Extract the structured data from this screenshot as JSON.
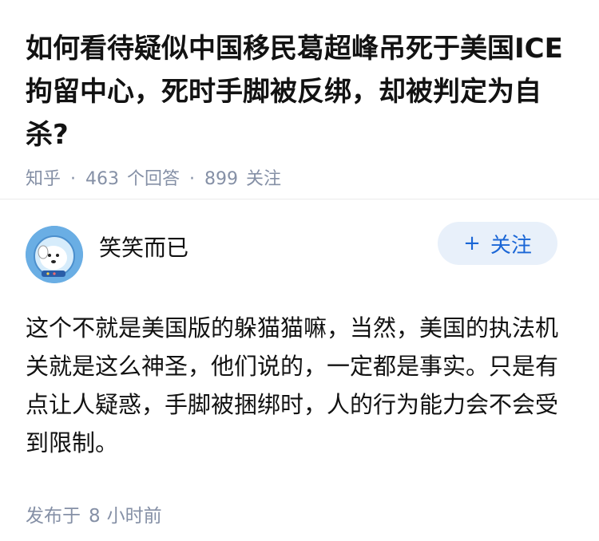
{
  "question": {
    "title": "如何看待疑似中国移民葛超峰吊死于美国ICE拘留中心，死时手脚被反绑，却被判定为自杀?",
    "source": "知乎",
    "answer_count": "463",
    "answer_label": "个回答",
    "follower_count": "899",
    "follower_label": "关注"
  },
  "answer": {
    "author_name": "笑笑而已",
    "follow_label": "关注",
    "follow_icon": "plus-icon",
    "avatar_icon": "cartoon-dog-avatar",
    "content": "这个不就是美国版的躲猫猫嘛，当然，美国的执法机关就是这么神圣，他们说的，一定都是事实。只是有点让人疑惑，手脚被捆绑时，人的行为能力会不会受到限制。",
    "time_prefix": "发布于",
    "time_value": "8",
    "time_suffix": "小时前"
  },
  "colors": {
    "accent": "#1a66d6",
    "accent_bg": "#e8f0fa",
    "meta_gray": "#8590a6",
    "text": "#121212"
  }
}
